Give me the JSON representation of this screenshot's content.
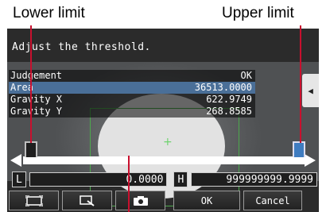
{
  "callouts": {
    "lower": "Lower limit",
    "upper": "Upper limit"
  },
  "screen": {
    "instruction": "Adjust the threshold.",
    "rows": [
      {
        "label": "Judgement",
        "value": "OK",
        "selected": false
      },
      {
        "label": "Area",
        "value": "36513.0000",
        "selected": true
      },
      {
        "label": "Gravity X",
        "value": "622.9749",
        "selected": false
      },
      {
        "label": "Gravity Y",
        "value": "268.8585",
        "selected": false
      }
    ],
    "side_button_icon": "triangle-left-icon",
    "lower_label": "L",
    "lower_value": "0.0000",
    "upper_label": "H",
    "upper_value": "999999999.9999",
    "toolbar": {
      "icon1": "frame-icon",
      "icon2": "zoom-icon",
      "icon3": "camera-icon",
      "ok": "OK",
      "cancel": "Cancel"
    }
  },
  "colors": {
    "selected_row": "#4a6f98",
    "upper_handle": "#3f7cc0",
    "leader_line": "#c8102e",
    "roi": "#4da84d"
  }
}
